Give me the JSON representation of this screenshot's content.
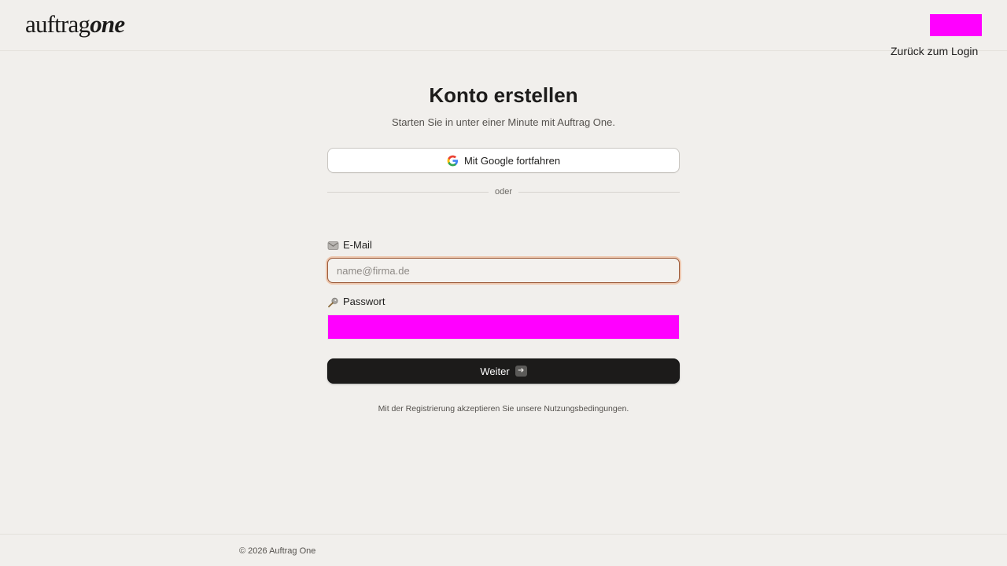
{
  "header": {
    "logo_light": "auftrag",
    "logo_bold": "one",
    "back_link": "Zurück zum Login"
  },
  "main": {
    "title": "Konto erstellen",
    "subtitle": "Starten Sie in unter einer Minute mit Auftrag One.",
    "google_button": "Mit Google fortfahren",
    "divider": "oder",
    "email_label": "E-Mail",
    "email_placeholder": "name@firma.de",
    "email_value": "",
    "password_label": "Passwort",
    "submit_label": "Weiter",
    "terms": "Mit der Registrierung akzeptieren Sie unsere Nutzungsbedingungen."
  },
  "footer": {
    "copyright": "© 2026 Auftrag One"
  },
  "icons": {
    "google": "google-icon",
    "email": "envelope-icon",
    "password": "key-icon",
    "submit": "arrow-right-icon"
  },
  "colors": {
    "background": "#f1efec",
    "primary_button": "#1c1b1a",
    "focus_ring": "#e89462",
    "redaction": "#ff00ff"
  }
}
